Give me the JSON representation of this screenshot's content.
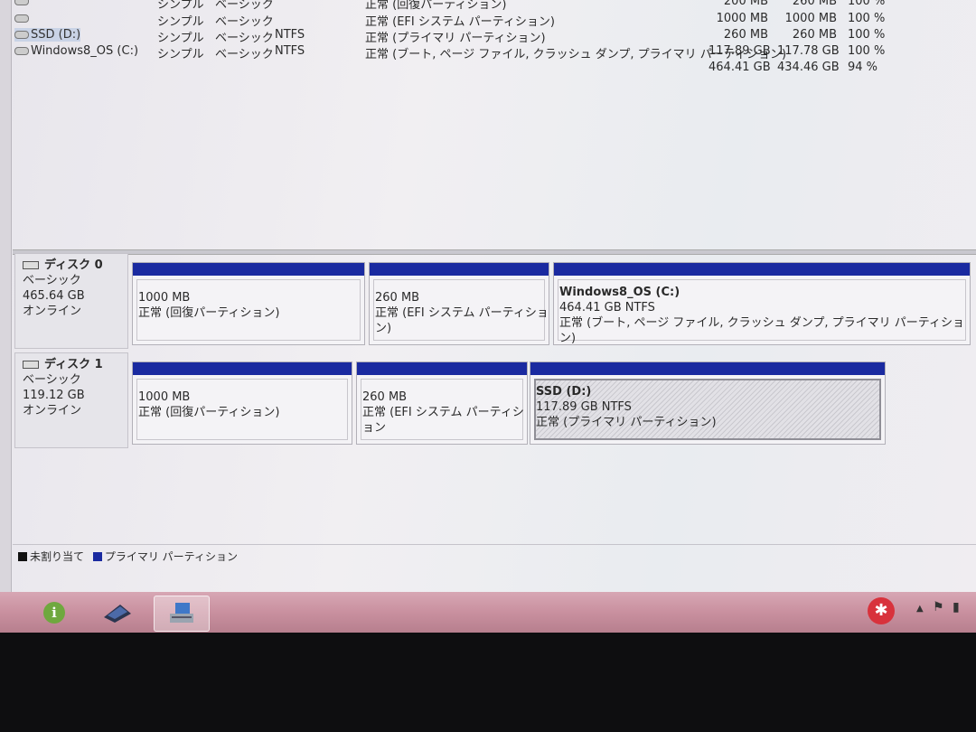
{
  "volumes": [
    {
      "name": "",
      "layout": "シンプル",
      "type": "ベーシック",
      "fs": "",
      "status": "正常 (回復パーティション)",
      "capacity": "200 MB",
      "free": "260 MB",
      "pct": "100 %"
    },
    {
      "name": "",
      "layout": "シンプル",
      "type": "ベーシック",
      "fs": "",
      "status": "正常 (EFI システム パーティション)",
      "capacity": "1000 MB",
      "free": "1000 MB",
      "pct": "100 %"
    },
    {
      "name": "SSD (D:)",
      "layout": "シンプル",
      "type": "ベーシック",
      "fs": "NTFS",
      "status": "正常 (プライマリ パーティション)",
      "capacity": "260 MB",
      "free": "260 MB",
      "pct": "100 %"
    },
    {
      "name": "Windows8_OS (C:)",
      "layout": "シンプル",
      "type": "ベーシック",
      "fs": "NTFS",
      "status": "正常 (ブート, ページ ファイル, クラッシュ ダンプ, プライマリ パーティション)",
      "capacity": "117.89 GB",
      "free": "117.78 GB",
      "pct": "100 %"
    },
    {
      "name": "",
      "layout": "",
      "type": "",
      "fs": "",
      "status": "",
      "capacity": "464.41 GB",
      "free": "434.46 GB",
      "pct": "94 %"
    }
  ],
  "disks": [
    {
      "name": "ディスク 0",
      "type": "ベーシック",
      "size": "465.64 GB",
      "state": "オンライン",
      "partitions": [
        {
          "title": "",
          "size": "1000 MB",
          "status": "正常 (回復パーティション)"
        },
        {
          "title": "",
          "size": "260 MB",
          "status": "正常 (EFI システム パーティション)"
        },
        {
          "title": "Windows8_OS  (C:)",
          "size": "464.41 GB NTFS",
          "status": "正常 (ブート, ページ ファイル, クラッシュ ダンプ, プライマリ パーティション)"
        }
      ]
    },
    {
      "name": "ディスク 1",
      "type": "ベーシック",
      "size": "119.12 GB",
      "state": "オンライン",
      "partitions": [
        {
          "title": "",
          "size": "1000 MB",
          "status": "正常 (回復パーティション)"
        },
        {
          "title": "",
          "size": "260 MB",
          "status": "正常 (EFI システム パーティション"
        },
        {
          "title": "SSD  (D:)",
          "size": "117.89 GB NTFS",
          "status": "正常 (プライマリ パーティション)"
        }
      ]
    }
  ],
  "legend": {
    "unallocated": "未割り当て",
    "primary": "プライマリ パーティション",
    "unallocated_color": "#111111",
    "primary_color": "#1a2aa0"
  },
  "taskbar": {
    "icons": [
      "info-icon",
      "scanner-icon",
      "disk-management-icon"
    ],
    "tray": [
      "action-center-icon",
      "network-icon",
      "battery-icon"
    ]
  }
}
